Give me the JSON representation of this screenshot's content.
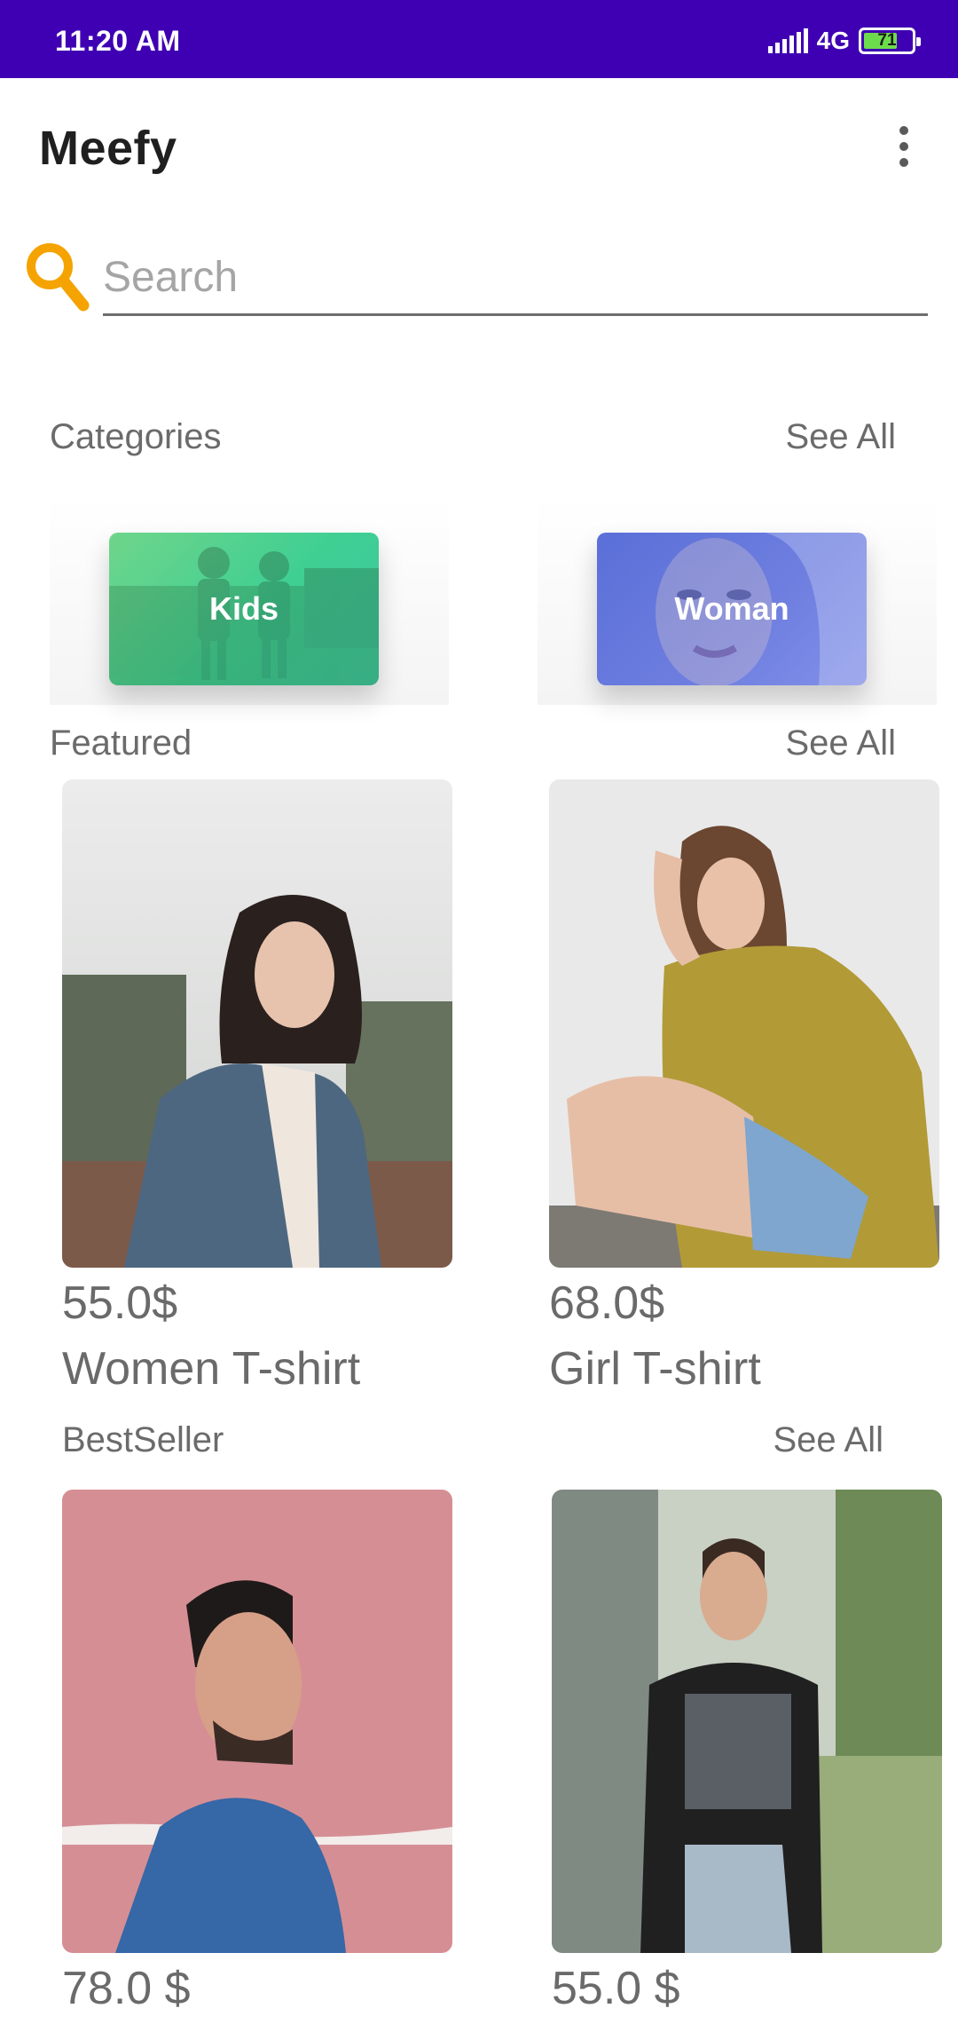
{
  "status_bar": {
    "time": "11:20 AM",
    "network": "4G",
    "battery": "71",
    "battery_level": 0.71
  },
  "app": {
    "title": "Meefy"
  },
  "search": {
    "placeholder": "Search",
    "value": ""
  },
  "categories": {
    "label": "Categories",
    "see_all": "See All",
    "items": [
      {
        "label": "Kids",
        "color": "#43cf8f"
      },
      {
        "label": "Woman",
        "color": "#6275dc"
      }
    ]
  },
  "featured": {
    "label": "Featured",
    "see_all": "See All",
    "items": [
      {
        "price": "55.0$",
        "name": "Women T-shirt"
      },
      {
        "price": "68.0$",
        "name": "Girl T-shirt"
      }
    ]
  },
  "bestseller": {
    "label": "BestSeller",
    "see_all": "See All",
    "items": [
      {
        "price": "78.0 $"
      },
      {
        "price": "55.0 $"
      }
    ]
  },
  "colors": {
    "status_bar": "#3f00b3",
    "search_icon": "#f5a300"
  }
}
